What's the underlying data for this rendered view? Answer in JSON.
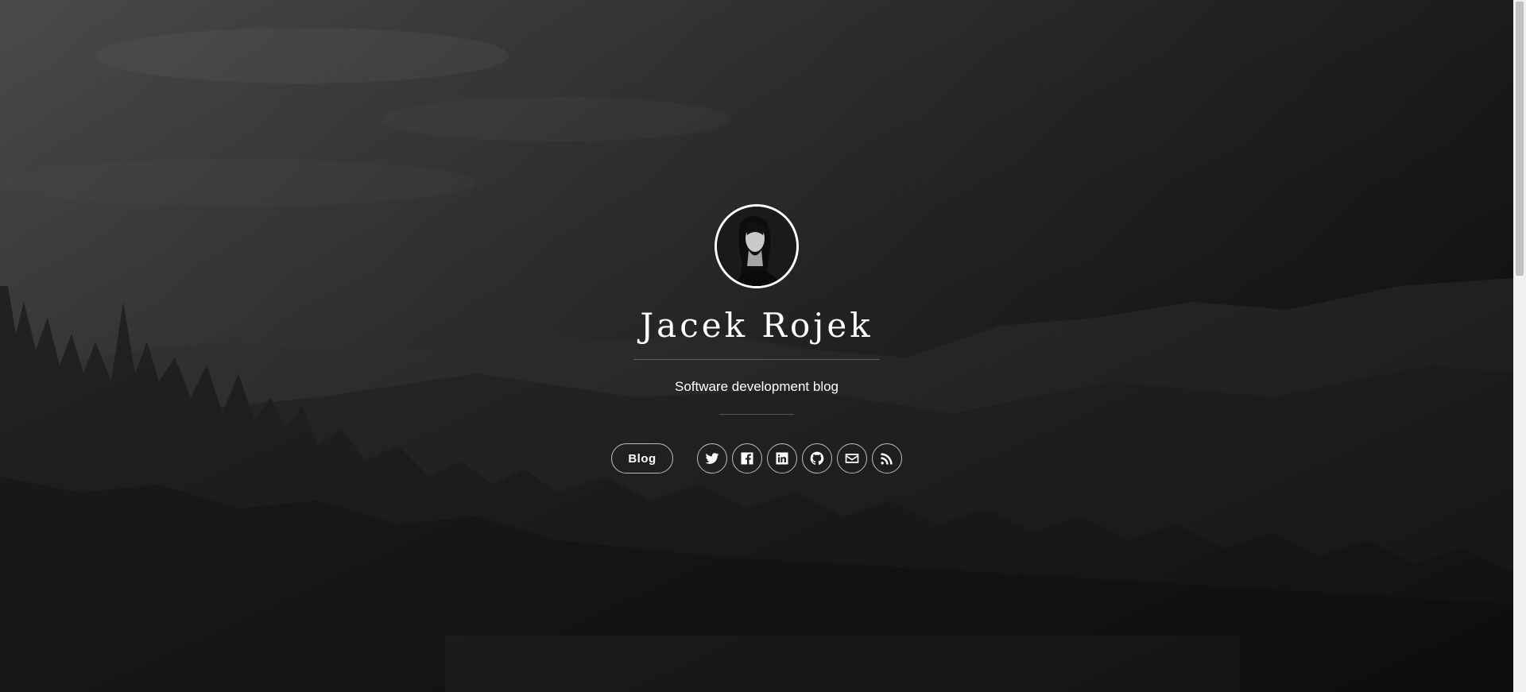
{
  "profile": {
    "name": "Jacek Rojek",
    "tagline": "Software development blog"
  },
  "nav": {
    "blog_label": "Blog"
  },
  "socials": [
    {
      "icon": "twitter-icon"
    },
    {
      "icon": "facebook-icon"
    },
    {
      "icon": "linkedin-icon"
    },
    {
      "icon": "github-icon"
    },
    {
      "icon": "email-icon"
    },
    {
      "icon": "rss-icon"
    }
  ],
  "colors": {
    "text": "#ffffff",
    "background": "#2a2a2a"
  }
}
